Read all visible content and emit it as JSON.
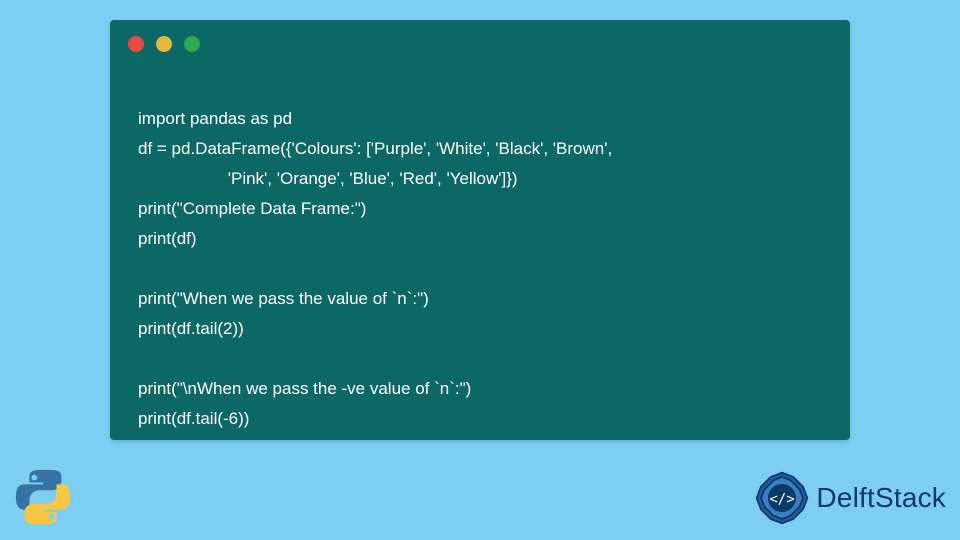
{
  "code": {
    "lines": [
      "import pandas as pd",
      "df = pd.DataFrame({'Colours': ['Purple', 'White', 'Black', 'Brown',",
      "                   'Pink', 'Orange', 'Blue', 'Red', 'Yellow']})",
      "print(\"Complete Data Frame:\")",
      "print(df)",
      "",
      "print(\"When we pass the value of `n`:\")",
      "print(df.tail(2))",
      "",
      "print(\"\\nWhen we pass the -ve value of `n`:\")",
      "print(df.tail(-6))"
    ]
  },
  "branding": {
    "site_name": "DelftStack"
  },
  "window_buttons": {
    "close": "close",
    "minimize": "minimize",
    "maximize": "maximize"
  },
  "language_icon": "python"
}
